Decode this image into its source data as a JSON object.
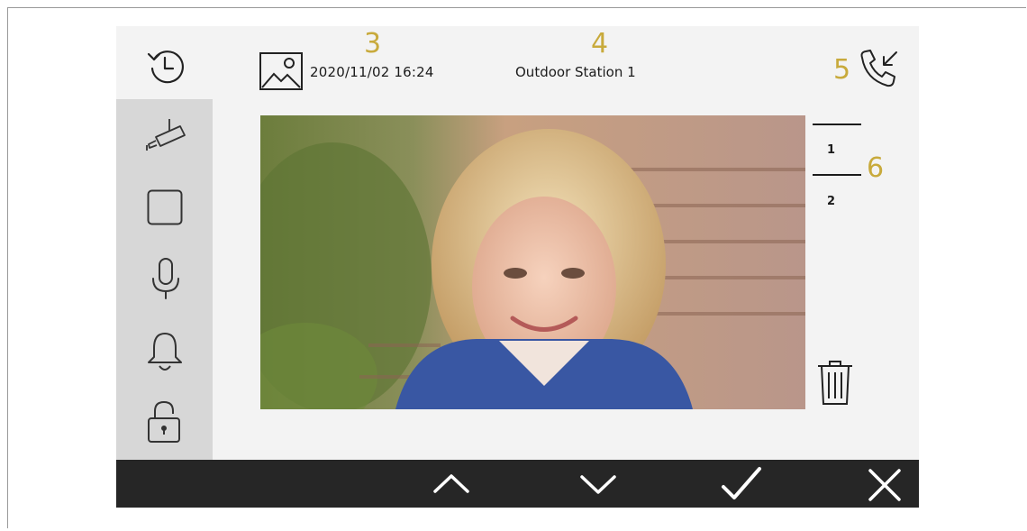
{
  "header": {
    "datetime": "2020/11/02 16:24",
    "station": "Outdoor Station 1"
  },
  "callouts": {
    "c3": "3",
    "c4": "4",
    "c5": "5",
    "c6": "6"
  },
  "pager": {
    "page1": "1",
    "page2": "2"
  },
  "icons": {
    "history": "history-icon",
    "gallery": "image-icon",
    "incoming_call": "incoming-call-icon",
    "camera": "camera-icon",
    "screen": "square-icon",
    "microphone": "microphone-icon",
    "bell": "bell-icon",
    "lock": "lock-icon",
    "trash": "trash-icon",
    "up": "chevron-up-icon",
    "down": "chevron-down-icon",
    "confirm": "check-icon",
    "close": "close-icon"
  },
  "colors": {
    "screen_bg": "#f3f3f3",
    "sidebar_bg": "#d7d7d7",
    "bottom_bar": "#262626",
    "callout": "#c8aa3c"
  }
}
